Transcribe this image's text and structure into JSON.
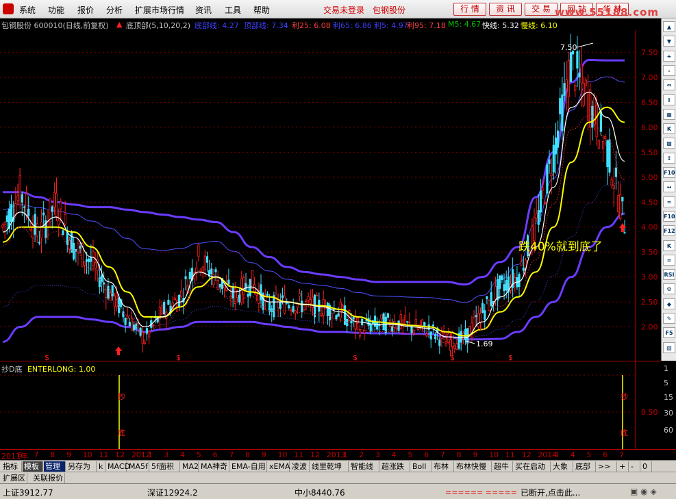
{
  "menu": {
    "items": [
      "系统",
      "功能",
      "报价",
      "分析",
      "扩展市场行情",
      "资讯",
      "工具",
      "帮助"
    ],
    "trade_status": "交易未登录",
    "stock_name": "包钢股份",
    "buttons": [
      "行 情",
      "资 讯",
      "交 易",
      "网 站",
      "华 林"
    ],
    "watermark": "www.55188.com"
  },
  "info": {
    "title": "包钢股份 600010(日线,前复权)",
    "indicator": "底顶部(5,10,20,2)",
    "items": [
      {
        "label": "底部线: 4.27",
        "color": "#4040ff"
      },
      {
        "label": "顶部线: 7.34",
        "color": "#4040ff"
      },
      {
        "label": "利25: 6.08",
        "color": "#ff4040"
      },
      {
        "label": "利65: 6.86",
        "color": "#4040ff"
      },
      {
        "label": "利5: 4.97",
        "color": "#4040ff"
      },
      {
        "label": "利95: 7.18",
        "color": "#ff4040"
      },
      {
        "label": "M5: 4.67",
        "color": "#00c000"
      },
      {
        "label": "快线: 5.32",
        "color": "#ffffff"
      },
      {
        "label": "慢线: 6.10",
        "color": "#ffff00"
      }
    ]
  },
  "chart_data": {
    "type": "line",
    "title": "包钢股份 600010(日线,前复权)",
    "yticks": [
      "7.50",
      "7.00",
      "6.50",
      "6.00",
      "5.50",
      "5.00",
      "4.50",
      "4.00",
      "3.50",
      "3.00",
      "2.50",
      "2.00"
    ],
    "ylim": [
      1.5,
      7.7
    ],
    "high_label": "7.50",
    "low_label": "1.69",
    "annotation": "跌40%就到底了",
    "close": [
      4.0,
      4.7,
      3.8,
      4.5,
      3.6,
      3.3,
      2.7,
      2.2,
      1.75,
      2.3,
      2.6,
      3.4,
      3.0,
      2.6,
      2.9,
      2.4,
      2.5,
      2.45,
      2.4,
      2.3,
      2.0,
      2.05,
      2.1,
      2.0,
      1.95,
      1.7,
      1.75,
      2.3,
      2.8,
      3.0,
      4.0,
      5.5,
      7.3,
      6.5,
      5.6,
      4.1
    ],
    "fast": [
      3.9,
      4.3,
      4.0,
      4.2,
      3.8,
      3.4,
      2.9,
      2.4,
      2.0,
      2.2,
      2.5,
      3.1,
      3.0,
      2.7,
      2.8,
      2.5,
      2.5,
      2.45,
      2.4,
      2.3,
      2.1,
      2.05,
      2.05,
      2.0,
      1.97,
      1.8,
      1.78,
      2.1,
      2.6,
      2.9,
      3.6,
      4.8,
      6.4,
      6.7,
      6.2,
      5.32
    ],
    "slow": [
      3.7,
      4.0,
      4.0,
      4.0,
      3.9,
      3.6,
      3.2,
      2.7,
      2.2,
      2.2,
      2.4,
      2.8,
      3.0,
      2.8,
      2.7,
      2.6,
      2.5,
      2.45,
      2.42,
      2.35,
      2.2,
      2.1,
      2.07,
      2.03,
      2.0,
      1.9,
      1.82,
      1.95,
      2.3,
      2.6,
      3.1,
      4.0,
      5.3,
      6.1,
      6.4,
      6.1
    ],
    "upper": [
      4.7,
      4.7,
      4.6,
      4.5,
      4.45,
      4.4,
      4.4,
      4.35,
      4.3,
      4.25,
      4.2,
      4.15,
      4.1,
      3.9,
      3.6,
      3.4,
      3.2,
      3.1,
      3.05,
      3.0,
      2.95,
      2.9,
      2.9,
      2.9,
      2.9,
      2.9,
      2.85,
      3.0,
      3.3,
      3.6,
      4.6,
      5.5,
      6.9,
      7.35,
      7.34,
      7.34
    ],
    "lower": [
      1.7,
      2.0,
      2.2,
      2.2,
      2.2,
      2.15,
      2.1,
      2.0,
      1.9,
      1.95,
      2.0,
      2.1,
      2.1,
      2.1,
      2.1,
      2.05,
      2.0,
      1.95,
      1.9,
      1.9,
      1.88,
      1.87,
      1.87,
      1.86,
      1.86,
      1.8,
      1.75,
      1.75,
      1.76,
      1.9,
      2.2,
      2.5,
      3.0,
      3.6,
      4.0,
      4.27
    ]
  },
  "sub": {
    "label": "抄D底",
    "value": "ENTERLONG: 1.00",
    "yticks": [
      "1.00",
      "0.50"
    ],
    "marks": [
      "抄",
      "底"
    ],
    "right_scale": [
      "1",
      "5",
      "15",
      "30",
      "60",
      "日线"
    ]
  },
  "dates": [
    "2011年",
    "6",
    "7",
    "8",
    "9",
    "10",
    "11",
    "12",
    "2012",
    "1",
    "3",
    "4",
    "5",
    "6",
    "7",
    "8",
    "9",
    "10",
    "11",
    "12",
    "2013",
    "1",
    "2",
    "3",
    "4",
    "5",
    "6",
    "7",
    "8",
    "9",
    "10",
    "11",
    "12",
    "2014",
    "3",
    "4",
    "5",
    "6",
    "7"
  ],
  "tabs": [
    "指标",
    "模板",
    "管理",
    "另存为",
    "k",
    "MACD",
    "MA5f",
    "5f面积",
    "MA2",
    "MA神奇",
    "EMA-自用",
    "xEMA",
    "凌波",
    "线里乾坤",
    "智能线",
    "超涨跌",
    "Boll",
    "布林",
    "布林快慢",
    "超牛",
    "买在启动",
    "大象",
    "底部",
    ">>",
    "+",
    "-",
    "0"
  ],
  "ext": [
    "扩展区",
    "关联报价"
  ],
  "status": {
    "sh": "上证3912.77",
    "sz": "深证12924.2",
    "mid": "中小8440.76",
    "conn": "已断开,点击此...",
    "ticker": "====== ====="
  },
  "right_icons": [
    "▲",
    "▼",
    "+",
    "-",
    "⇔",
    "⇕",
    "▦",
    "K",
    "▩",
    "↕",
    "F10",
    "↔",
    "≈",
    "F10",
    "F12",
    "K",
    "≈",
    "RSI",
    "⚙",
    "◆",
    "✎",
    "F5",
    "▧"
  ]
}
